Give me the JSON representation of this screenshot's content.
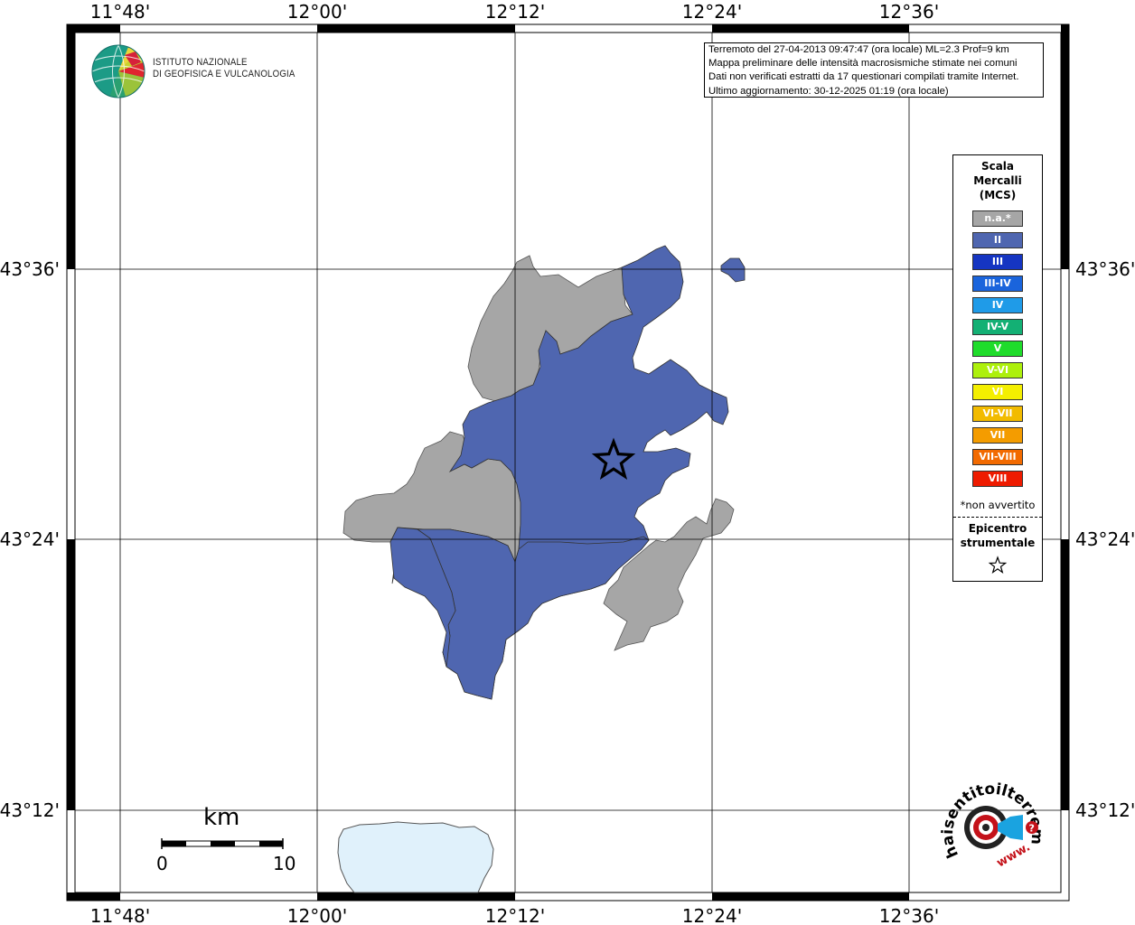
{
  "map": {
    "lon_ticks": [
      "11°48'",
      "12°00'",
      "12°12'",
      "12°24'",
      "12°36'"
    ],
    "lat_ticks": [
      "43°36'",
      "43°24'",
      "43°12'"
    ]
  },
  "info": {
    "lines": [
      "Terremoto del 27-04-2013 09:47:47 (ora locale) ML=2.3 Prof=9 km",
      "Mappa preliminare delle intensità macrosismiche stimate nei comuni",
      "Dati non verificati estratti da 17 questionari compilati tramite Internet.",
      "Ultimo aggiornamento: 30-12-2025 01:19 (ora locale)"
    ]
  },
  "logo": {
    "line1": "ISTITUTO NAZIONALE",
    "line2": "DI GEOFISICA E VULCANOLOGIA"
  },
  "legend": {
    "title_lines": [
      "Scala",
      "Mercalli",
      "(MCS)"
    ],
    "items": [
      {
        "label": "n.a.*",
        "color": "#a6a6a6"
      },
      {
        "label": "II",
        "color": "#4f66b0"
      },
      {
        "label": "III",
        "color": "#1535c2"
      },
      {
        "label": "III-IV",
        "color": "#1a64dc"
      },
      {
        "label": "IV",
        "color": "#1f9be8"
      },
      {
        "label": "IV-V",
        "color": "#13b074"
      },
      {
        "label": "V",
        "color": "#1fdc2b"
      },
      {
        "label": "V-VI",
        "color": "#adf00c"
      },
      {
        "label": "VI",
        "color": "#f4ef00"
      },
      {
        "label": "VI-VII",
        "color": "#f2bb00"
      },
      {
        "label": "VII",
        "color": "#f49c00"
      },
      {
        "label": "VII-VIII",
        "color": "#f26a00"
      },
      {
        "label": "VIII",
        "color": "#ee1b00"
      }
    ],
    "note": "*non avvertito",
    "epicenter_lines": [
      "Epicentro",
      "strumentale"
    ]
  },
  "scalebar": {
    "unit": "km",
    "start": "0",
    "end": "10"
  },
  "watermark": {
    "text": "haisentitoilterremoto.it",
    "www": "www."
  },
  "colors": {
    "na": "#a6a6a6",
    "ii": "#4f66b0",
    "lake": "#e0f1fb"
  }
}
